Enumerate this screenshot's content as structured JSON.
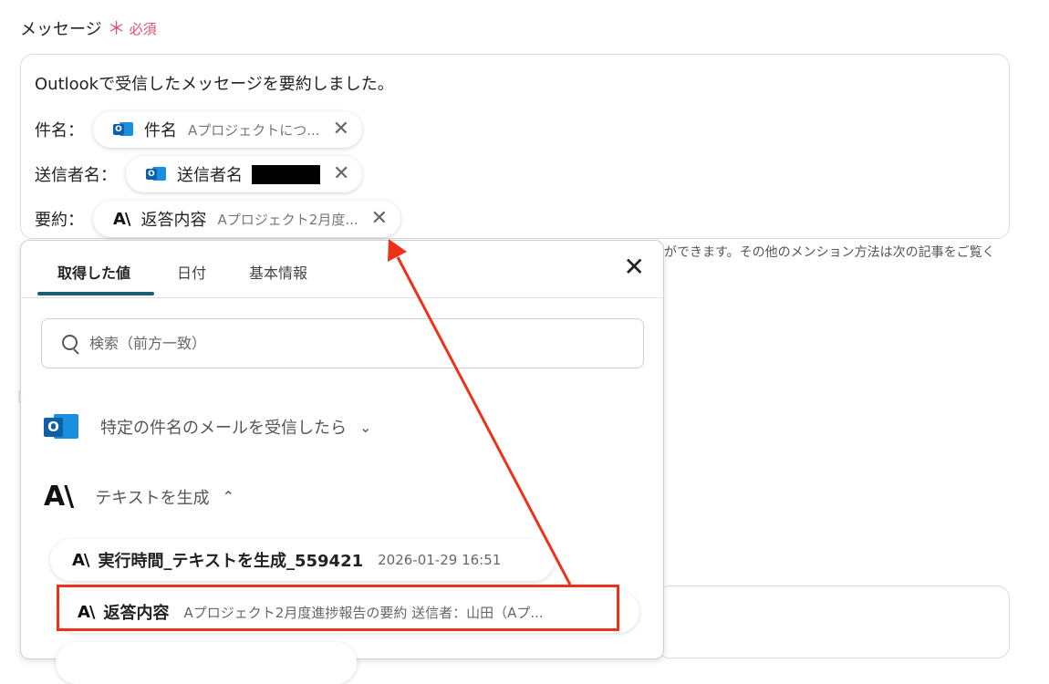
{
  "field": {
    "label": "メッセージ",
    "required_star": "＊",
    "required_text": "必須"
  },
  "editor": {
    "line1": "Outlookで受信したメッセージを要約しました。",
    "line2": {
      "label": "件名：",
      "pill_name": "件名",
      "pill_value": "Aプロジェクトにつ..."
    },
    "line3": {
      "label": "送信者名：",
      "pill_name": "送信者名"
    },
    "line4": {
      "label": "要約：",
      "pill_name": "返答内容",
      "pill_value": "Aプロジェクト2月度..."
    }
  },
  "helper_text": "ができます。その他のメンション方法は次の記事をご覧く",
  "panel": {
    "tabs": [
      "取得した値",
      "日付",
      "基本情報"
    ],
    "active_tab": "取得した値",
    "close": "✕",
    "search_placeholder": "検索（前方一致）",
    "sections": [
      {
        "title": "特定の件名のメールを受信したら",
        "chevron": "⌄",
        "icon": "outlook-icon"
      },
      {
        "title": "テキストを生成",
        "chevron": "⌃",
        "icon": "anthropic-icon"
      }
    ],
    "items": [
      {
        "name": "実行時間_テキストを生成_559421",
        "value": "2026-01-29 16:51"
      },
      {
        "name": "返答内容",
        "value": "Aプロジェクト2月度進捗報告の要約 送信者：山田（Aプ..."
      }
    ]
  },
  "icons": {
    "outlook_letter": "O",
    "anthropic_mark": "A\\",
    "pill_close": "✕"
  },
  "colors": {
    "required": "#e2506a",
    "tab_underline": "#1c5f73",
    "annotation": "#ea3318",
    "outlook_blue": "#1a8fe0"
  }
}
